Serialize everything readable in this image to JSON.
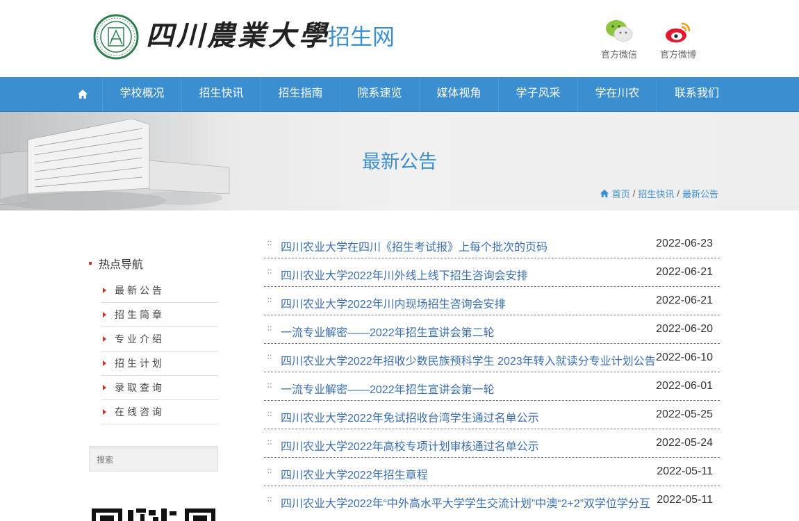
{
  "header": {
    "logo_name": "四川農業大學",
    "logo_dot": "·",
    "logo_sub": "招生网",
    "wechat_label": "官方微信",
    "weibo_label": "官方微博"
  },
  "nav": {
    "items": [
      "学校概况",
      "招生快讯",
      "招生指南",
      "院系速览",
      "媒体视角",
      "学子风采",
      "学在川农",
      "联系我们"
    ]
  },
  "banner": {
    "title": "最新公告",
    "breadcrumb": [
      "首页",
      "招生快讯",
      "最新公告"
    ],
    "breadcrumb_sep": "/"
  },
  "sidebar": {
    "title": "热点导航",
    "items": [
      "最新公告",
      "招生简章",
      "专业介绍",
      "招生计划",
      "录取查询",
      "在线咨询"
    ],
    "search_placeholder": "搜索"
  },
  "news": [
    {
      "title": "四川农业大学在四川《招生考试报》上每个批次的页码",
      "date": "2022-06-23"
    },
    {
      "title": "四川农业大学2022年川外线上线下招生咨询会安排",
      "date": "2022-06-21"
    },
    {
      "title": "四川农业大学2022年川内现场招生咨询会安排",
      "date": "2022-06-21"
    },
    {
      "title": "一流专业解密——2022年招生宣讲会第二轮",
      "date": "2022-06-20"
    },
    {
      "title": "四川农业大学2022年招收少数民族预科学生 2023年转入就读分专业计划公告",
      "date": "2022-06-10"
    },
    {
      "title": "一流专业解密——2022年招生宣讲会第一轮",
      "date": "2022-06-01"
    },
    {
      "title": "四川农业大学2022年免试招收台湾学生通过名单公示",
      "date": "2022-05-25"
    },
    {
      "title": "四川农业大学2022年高校专项计划审核通过名单公示",
      "date": "2022-05-24"
    },
    {
      "title": "四川农业大学2022年招生章程",
      "date": "2022-05-11"
    },
    {
      "title": "四川农业大学2022年“中外高水平大学学生交流计划”中澳“2+2”双学位学分互",
      "date": "2022-05-11"
    }
  ],
  "colors": {
    "brand_blue": "#3b8fd0",
    "link_blue": "#3b6fb0",
    "accent_red": "#c0392b"
  }
}
